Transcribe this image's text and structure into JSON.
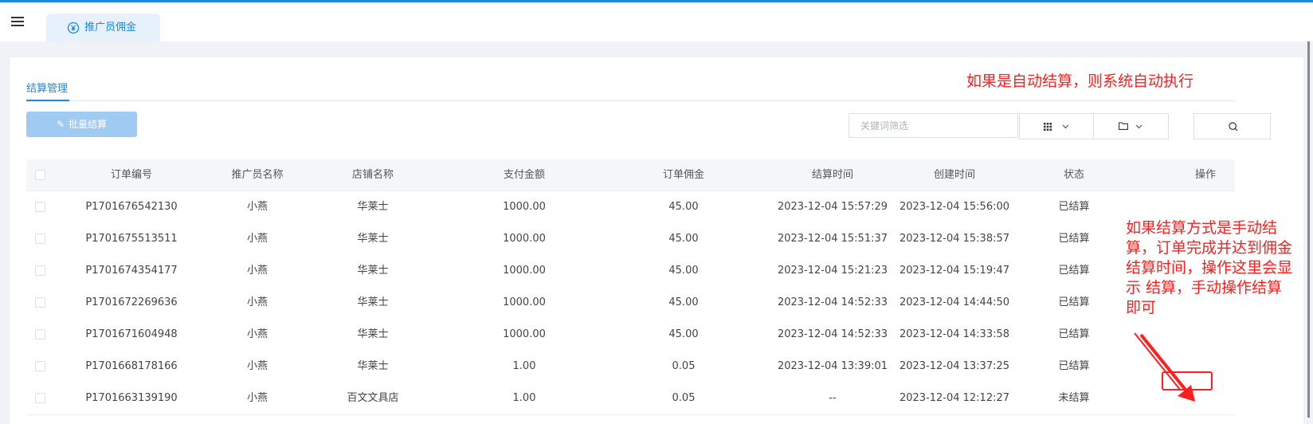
{
  "header": {
    "tab_label": "推广员佣金"
  },
  "main": {
    "subtab_label": "结算管理",
    "batch_button_label": "批量结算",
    "search_placeholder": "关键词筛选"
  },
  "annotations": {
    "auto_note": "如果是自动结算，则系统自动执行",
    "manual_note": "如果结算方式是手动结算，订单完成并达到佣金结算时间，操作这里会显示  结算，手动操作结算即可"
  },
  "table": {
    "columns": [
      "订单编号",
      "推广员名称",
      "店铺名称",
      "支付金额",
      "订单佣金",
      "结算时间",
      "创建时间",
      "状态",
      "操作"
    ],
    "rows": [
      [
        "P1701676542130",
        "小燕",
        "华莱士",
        "1000.00",
        "45.00",
        "2023-12-04 15:57:29",
        "2023-12-04 15:56:00",
        "已结算",
        ""
      ],
      [
        "P1701675513511",
        "小燕",
        "华莱士",
        "1000.00",
        "45.00",
        "2023-12-04 15:51:37",
        "2023-12-04 15:38:57",
        "已结算",
        ""
      ],
      [
        "P1701674354177",
        "小燕",
        "华莱士",
        "1000.00",
        "45.00",
        "2023-12-04 15:21:23",
        "2023-12-04 15:19:47",
        "已结算",
        ""
      ],
      [
        "P1701672269636",
        "小燕",
        "华莱士",
        "1000.00",
        "45.00",
        "2023-12-04 14:52:33",
        "2023-12-04 14:44:50",
        "已结算",
        ""
      ],
      [
        "P1701671604948",
        "小燕",
        "华莱士",
        "1000.00",
        "45.00",
        "2023-12-04 14:52:33",
        "2023-12-04 14:33:58",
        "已结算",
        ""
      ],
      [
        "P1701668178166",
        "小燕",
        "华莱士",
        "1.00",
        "0.05",
        "2023-12-04 13:39:01",
        "2023-12-04 13:37:25",
        "已结算",
        ""
      ],
      [
        "P1701663139190",
        "小燕",
        "百文文具店",
        "1.00",
        "0.05",
        "--",
        "2023-12-04 12:12:27",
        "未结算",
        ""
      ]
    ]
  },
  "icons": {
    "menu": "hamburger-icon",
    "tab": "yuan-coin-icon",
    "batch": "pencil-icon",
    "columns": "grid-icon",
    "export": "folder-icon",
    "search": "search-icon"
  },
  "colors": {
    "primary": "#1e88e5",
    "annotation": "#ff1e1e"
  }
}
